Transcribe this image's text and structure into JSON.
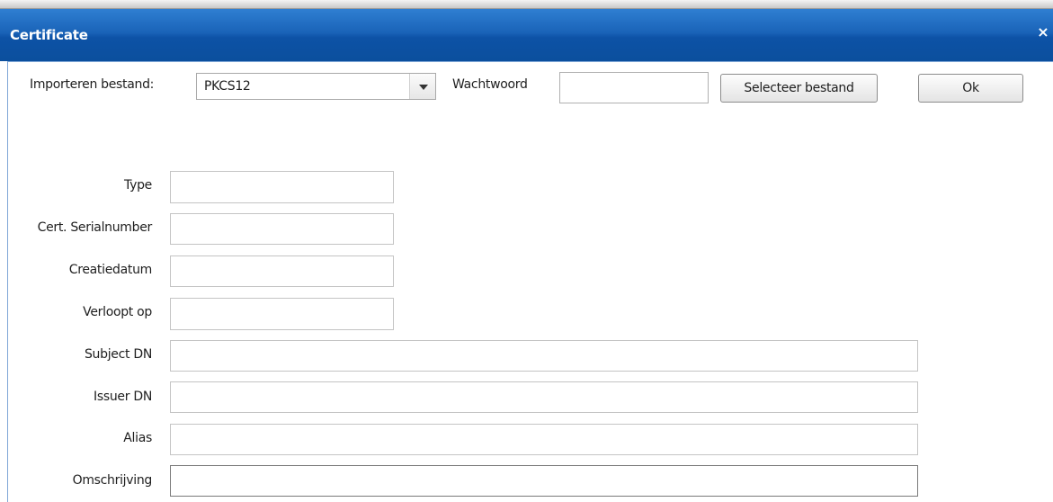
{
  "window": {
    "title": "Certificate",
    "close_glyph": "×",
    "close_icon": "close-icon"
  },
  "toolbar": {
    "import_label": "Importeren bestand:",
    "import_type": {
      "selected": "PKCS12",
      "arrow_icon": "chevron-down-icon"
    },
    "password_label": "Wachtwoord",
    "password_value": "",
    "select_file_label": "Selecteer bestand",
    "ok_label": "Ok"
  },
  "form": {
    "type_label": "Type",
    "serial_label": "Cert. Serialnumber",
    "created_label": "Creatiedatum",
    "expires_label": "Verloopt op",
    "subject_label": "Subject DN",
    "issuer_label": "Issuer DN",
    "alias_label": "Alias",
    "description_label": "Omschrijving"
  },
  "colors": {
    "title_bar": "#1a63b8",
    "panel_border": "#7fa6d6"
  }
}
